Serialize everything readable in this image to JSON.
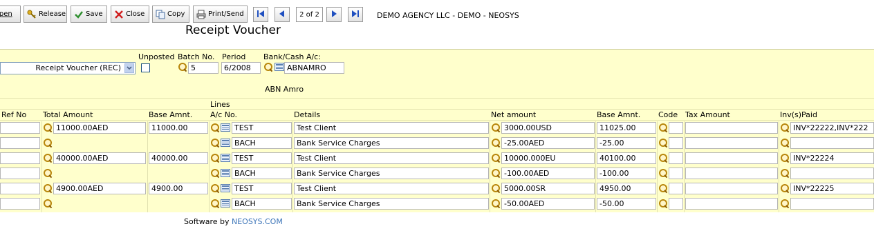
{
  "toolbar": {
    "open_label": "Open",
    "release_label": "Release",
    "save_label": "Save",
    "close_label": "Close",
    "copy_label": "Copy",
    "print_label": "Print/Send",
    "page_indicator": "2 of 2",
    "agency": "DEMO AGENCY LLC - DEMO - NEOSYS"
  },
  "title": "Receipt Voucher",
  "header": {
    "type_value": "Receipt Voucher (REC)",
    "unposted_label": "Unposted",
    "batch_label": "Batch No.",
    "batch_value": "5",
    "period_label": "Period",
    "period_value": "6/2008",
    "bank_label": "Bank/Cash A/c:",
    "bank_value": "ABNAMRO",
    "bank_name": "ABN Amro"
  },
  "table": {
    "lines_label": "Lines",
    "columns": {
      "ref_no": "Ref No",
      "total_amount": "Total Amount",
      "base_amnt": "Base Amnt.",
      "ac_no": "A/c No.",
      "details": "Details",
      "net_amount": "Net amount",
      "base_amnt2": "Base Amnt.",
      "code": "Code",
      "tax_amount": "Tax Amount",
      "inv_paid": "Inv(s)Paid"
    },
    "rows": [
      {
        "total": "11000.00AED",
        "base": "11000.00",
        "ac": "TEST",
        "details": "Test Client",
        "net": "3000.00USD",
        "base2": "11025.00",
        "inv": "INV*22222,INV*222"
      },
      {
        "total": "",
        "base": "",
        "ac": "BACH",
        "details": "Bank Service Charges",
        "net": "-25.00AED",
        "base2": "-25.00",
        "inv": ""
      },
      {
        "total": "40000.00AED",
        "base": "40000.00",
        "ac": "TEST",
        "details": "Test Client",
        "net": "10000.000EU",
        "base2": "40100.00",
        "inv": "INV*22224"
      },
      {
        "total": "",
        "base": "",
        "ac": "BACH",
        "details": "Bank Service Charges",
        "net": "-100.00AED",
        "base2": "-100.00",
        "inv": ""
      },
      {
        "total": "4900.00AED",
        "base": "4900.00",
        "ac": "TEST",
        "details": "Test Client",
        "net": "5000.00SR",
        "base2": "4950.00",
        "inv": "INV*22225"
      },
      {
        "total": "",
        "base": "",
        "ac": "BACH",
        "details": "Bank Service Charges",
        "net": "-50.00AED",
        "base2": "-50.00",
        "inv": ""
      }
    ]
  },
  "footer": {
    "prefix": "Software by",
    "link": "NEOSYS.COM"
  }
}
